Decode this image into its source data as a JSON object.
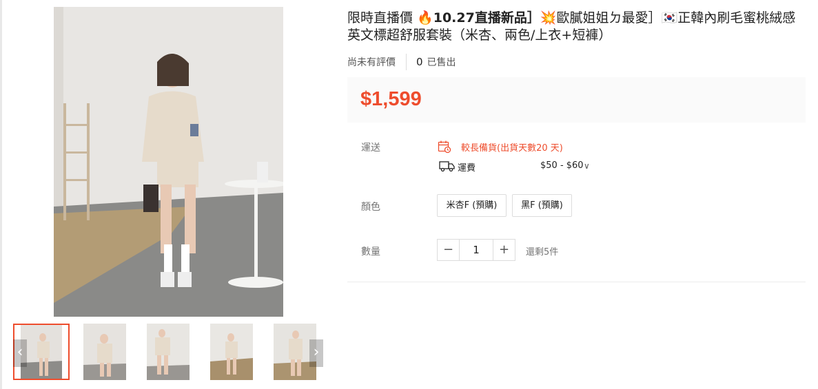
{
  "product": {
    "title_line1_a": "限時直播價 ",
    "title_line1_b": "🔥",
    "title_line1_c": "10.27直播新品］",
    "title_line1_d": "💥",
    "title_line1_e": "歐膩姐姐ㄉ最愛］",
    "title_line1_f": "🇰🇷",
    "title_line1_g": "正韓內刷毛蜜桃絨感",
    "title_line2": "英文標超舒服套裝（米杏、兩色/上衣+短褲）",
    "rating_text": "尚未有評價",
    "sold_count": "0",
    "sold_label": "已售出",
    "price": "$1,599"
  },
  "shipping": {
    "label": "運送",
    "warning": "較長備貨(出貨天數20 天)",
    "fee_label": "運費",
    "fee_value": "$50 - $60",
    "chevron": "∨"
  },
  "color": {
    "label": "顏色",
    "options": [
      "米杏F (預購)",
      "黑F (預購)"
    ]
  },
  "quantity": {
    "label": "數量",
    "minus": "−",
    "value": "1",
    "plus": "+",
    "stock": "還剩5件"
  },
  "gallery": {
    "prev": "‹",
    "next": "›",
    "thumb_count": 5,
    "selected_index": 0
  },
  "colors": {
    "accent": "#ee4d2d",
    "price_bg": "#fafafa"
  }
}
